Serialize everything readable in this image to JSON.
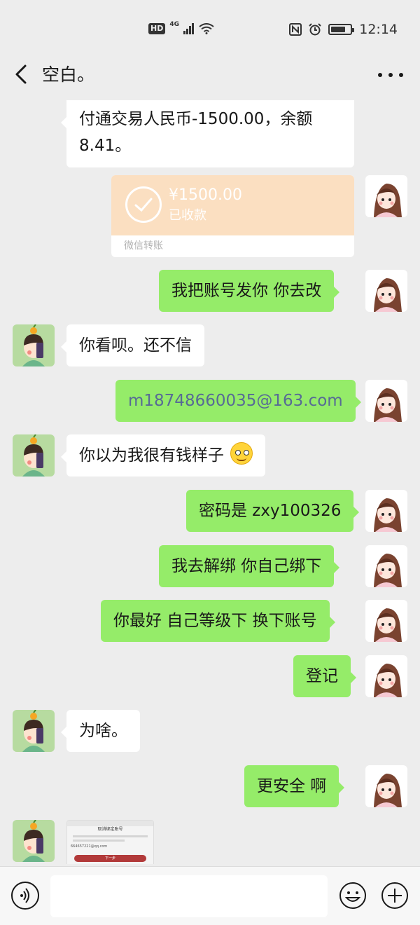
{
  "status_bar": {
    "network_badge": "HD",
    "signal_label": "4G",
    "time": "12:14",
    "battery_level": 0.75,
    "icons": [
      "hd-icon",
      "signal-icon",
      "wifi-icon",
      "nfc-icon",
      "alarm-icon",
      "battery-icon"
    ]
  },
  "header": {
    "title": "空白。",
    "icons": [
      "back-icon",
      "more-icon"
    ]
  },
  "messages": {
    "m0": "付通交易人民币-1500.00，余额8.41。",
    "transfer_amount": "¥1500.00",
    "transfer_status": "已收款",
    "transfer_label": "微信转账",
    "m2": "我把账号发你  你去改",
    "m3": "你看呗。还不信",
    "m4": "m18748660035@163.com",
    "m5": "你以为我很有钱样子",
    "m6": "密码是 zxy100326",
    "m7": "我去解绑  你自己绑下",
    "m8": "你最好 自己等级下  换下账号",
    "m9": "登记",
    "m10": "为啥。",
    "m11": "更安全 啊"
  },
  "thumbnail": {
    "title": "取消绑定账号",
    "email": "664657221@qq.com",
    "button": "下一步"
  },
  "input_bar": {
    "placeholder": "",
    "icons": [
      "voice-icon",
      "emoji-icon",
      "plus-icon"
    ]
  },
  "colors": {
    "background": "#ededed",
    "outgoing_bubble": "#95ec69",
    "incoming_bubble": "#ffffff",
    "transfer_card": "#fbdfc1",
    "link": "#576b95"
  }
}
